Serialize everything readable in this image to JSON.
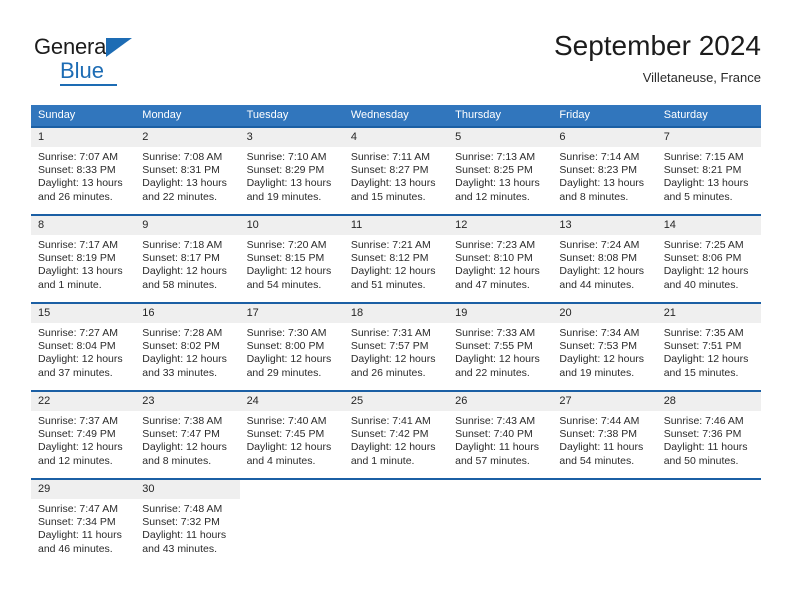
{
  "brand": {
    "name_top": "General",
    "name_bottom": "Blue",
    "accent_color": "#1d6cb4"
  },
  "header": {
    "title": "September 2024",
    "location": "Villetaneuse, France"
  },
  "theme": {
    "header_blue": "#3176bd",
    "row_divider_blue": "#1b5fa4",
    "daynum_band_gray": "#efefef",
    "text_color": "#2b2b2b"
  },
  "weekdays": [
    "Sunday",
    "Monday",
    "Tuesday",
    "Wednesday",
    "Thursday",
    "Friday",
    "Saturday"
  ],
  "weeks": [
    [
      {
        "day": "1",
        "sunrise": "Sunrise: 7:07 AM",
        "sunset": "Sunset: 8:33 PM",
        "daylight_1": "Daylight: 13 hours",
        "daylight_2": "and 26 minutes."
      },
      {
        "day": "2",
        "sunrise": "Sunrise: 7:08 AM",
        "sunset": "Sunset: 8:31 PM",
        "daylight_1": "Daylight: 13 hours",
        "daylight_2": "and 22 minutes."
      },
      {
        "day": "3",
        "sunrise": "Sunrise: 7:10 AM",
        "sunset": "Sunset: 8:29 PM",
        "daylight_1": "Daylight: 13 hours",
        "daylight_2": "and 19 minutes."
      },
      {
        "day": "4",
        "sunrise": "Sunrise: 7:11 AM",
        "sunset": "Sunset: 8:27 PM",
        "daylight_1": "Daylight: 13 hours",
        "daylight_2": "and 15 minutes."
      },
      {
        "day": "5",
        "sunrise": "Sunrise: 7:13 AM",
        "sunset": "Sunset: 8:25 PM",
        "daylight_1": "Daylight: 13 hours",
        "daylight_2": "and 12 minutes."
      },
      {
        "day": "6",
        "sunrise": "Sunrise: 7:14 AM",
        "sunset": "Sunset: 8:23 PM",
        "daylight_1": "Daylight: 13 hours",
        "daylight_2": "and 8 minutes."
      },
      {
        "day": "7",
        "sunrise": "Sunrise: 7:15 AM",
        "sunset": "Sunset: 8:21 PM",
        "daylight_1": "Daylight: 13 hours",
        "daylight_2": "and 5 minutes."
      }
    ],
    [
      {
        "day": "8",
        "sunrise": "Sunrise: 7:17 AM",
        "sunset": "Sunset: 8:19 PM",
        "daylight_1": "Daylight: 13 hours",
        "daylight_2": "and 1 minute."
      },
      {
        "day": "9",
        "sunrise": "Sunrise: 7:18 AM",
        "sunset": "Sunset: 8:17 PM",
        "daylight_1": "Daylight: 12 hours",
        "daylight_2": "and 58 minutes."
      },
      {
        "day": "10",
        "sunrise": "Sunrise: 7:20 AM",
        "sunset": "Sunset: 8:15 PM",
        "daylight_1": "Daylight: 12 hours",
        "daylight_2": "and 54 minutes."
      },
      {
        "day": "11",
        "sunrise": "Sunrise: 7:21 AM",
        "sunset": "Sunset: 8:12 PM",
        "daylight_1": "Daylight: 12 hours",
        "daylight_2": "and 51 minutes."
      },
      {
        "day": "12",
        "sunrise": "Sunrise: 7:23 AM",
        "sunset": "Sunset: 8:10 PM",
        "daylight_1": "Daylight: 12 hours",
        "daylight_2": "and 47 minutes."
      },
      {
        "day": "13",
        "sunrise": "Sunrise: 7:24 AM",
        "sunset": "Sunset: 8:08 PM",
        "daylight_1": "Daylight: 12 hours",
        "daylight_2": "and 44 minutes."
      },
      {
        "day": "14",
        "sunrise": "Sunrise: 7:25 AM",
        "sunset": "Sunset: 8:06 PM",
        "daylight_1": "Daylight: 12 hours",
        "daylight_2": "and 40 minutes."
      }
    ],
    [
      {
        "day": "15",
        "sunrise": "Sunrise: 7:27 AM",
        "sunset": "Sunset: 8:04 PM",
        "daylight_1": "Daylight: 12 hours",
        "daylight_2": "and 37 minutes."
      },
      {
        "day": "16",
        "sunrise": "Sunrise: 7:28 AM",
        "sunset": "Sunset: 8:02 PM",
        "daylight_1": "Daylight: 12 hours",
        "daylight_2": "and 33 minutes."
      },
      {
        "day": "17",
        "sunrise": "Sunrise: 7:30 AM",
        "sunset": "Sunset: 8:00 PM",
        "daylight_1": "Daylight: 12 hours",
        "daylight_2": "and 29 minutes."
      },
      {
        "day": "18",
        "sunrise": "Sunrise: 7:31 AM",
        "sunset": "Sunset: 7:57 PM",
        "daylight_1": "Daylight: 12 hours",
        "daylight_2": "and 26 minutes."
      },
      {
        "day": "19",
        "sunrise": "Sunrise: 7:33 AM",
        "sunset": "Sunset: 7:55 PM",
        "daylight_1": "Daylight: 12 hours",
        "daylight_2": "and 22 minutes."
      },
      {
        "day": "20",
        "sunrise": "Sunrise: 7:34 AM",
        "sunset": "Sunset: 7:53 PM",
        "daylight_1": "Daylight: 12 hours",
        "daylight_2": "and 19 minutes."
      },
      {
        "day": "21",
        "sunrise": "Sunrise: 7:35 AM",
        "sunset": "Sunset: 7:51 PM",
        "daylight_1": "Daylight: 12 hours",
        "daylight_2": "and 15 minutes."
      }
    ],
    [
      {
        "day": "22",
        "sunrise": "Sunrise: 7:37 AM",
        "sunset": "Sunset: 7:49 PM",
        "daylight_1": "Daylight: 12 hours",
        "daylight_2": "and 12 minutes."
      },
      {
        "day": "23",
        "sunrise": "Sunrise: 7:38 AM",
        "sunset": "Sunset: 7:47 PM",
        "daylight_1": "Daylight: 12 hours",
        "daylight_2": "and 8 minutes."
      },
      {
        "day": "24",
        "sunrise": "Sunrise: 7:40 AM",
        "sunset": "Sunset: 7:45 PM",
        "daylight_1": "Daylight: 12 hours",
        "daylight_2": "and 4 minutes."
      },
      {
        "day": "25",
        "sunrise": "Sunrise: 7:41 AM",
        "sunset": "Sunset: 7:42 PM",
        "daylight_1": "Daylight: 12 hours",
        "daylight_2": "and 1 minute."
      },
      {
        "day": "26",
        "sunrise": "Sunrise: 7:43 AM",
        "sunset": "Sunset: 7:40 PM",
        "daylight_1": "Daylight: 11 hours",
        "daylight_2": "and 57 minutes."
      },
      {
        "day": "27",
        "sunrise": "Sunrise: 7:44 AM",
        "sunset": "Sunset: 7:38 PM",
        "daylight_1": "Daylight: 11 hours",
        "daylight_2": "and 54 minutes."
      },
      {
        "day": "28",
        "sunrise": "Sunrise: 7:46 AM",
        "sunset": "Sunset: 7:36 PM",
        "daylight_1": "Daylight: 11 hours",
        "daylight_2": "and 50 minutes."
      }
    ],
    [
      {
        "day": "29",
        "sunrise": "Sunrise: 7:47 AM",
        "sunset": "Sunset: 7:34 PM",
        "daylight_1": "Daylight: 11 hours",
        "daylight_2": "and 46 minutes."
      },
      {
        "day": "30",
        "sunrise": "Sunrise: 7:48 AM",
        "sunset": "Sunset: 7:32 PM",
        "daylight_1": "Daylight: 11 hours",
        "daylight_2": "and 43 minutes."
      },
      {
        "day": "",
        "sunrise": "",
        "sunset": "",
        "daylight_1": "",
        "daylight_2": ""
      },
      {
        "day": "",
        "sunrise": "",
        "sunset": "",
        "daylight_1": "",
        "daylight_2": ""
      },
      {
        "day": "",
        "sunrise": "",
        "sunset": "",
        "daylight_1": "",
        "daylight_2": ""
      },
      {
        "day": "",
        "sunrise": "",
        "sunset": "",
        "daylight_1": "",
        "daylight_2": ""
      },
      {
        "day": "",
        "sunrise": "",
        "sunset": "",
        "daylight_1": "",
        "daylight_2": ""
      }
    ]
  ]
}
